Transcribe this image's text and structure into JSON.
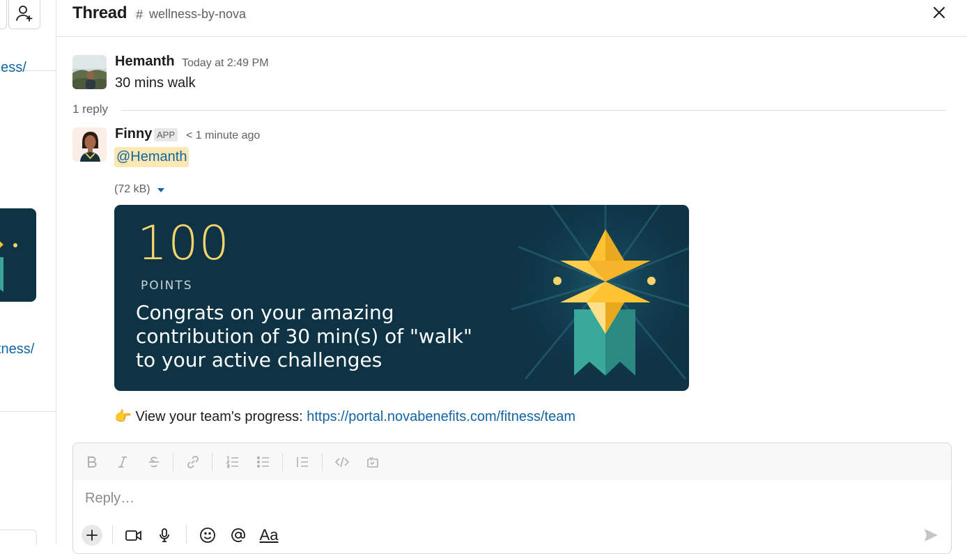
{
  "sidebar": {
    "link_fragment_1": "ness/",
    "link_fragment_2": "tness/"
  },
  "header": {
    "title": "Thread",
    "channel_hash": "#",
    "channel": "wellness-by-nova"
  },
  "parent_message": {
    "author": "Hemanth",
    "timestamp": "Today at 2:49 PM",
    "text": "30 mins walk"
  },
  "reply_count": "1 reply",
  "reply": {
    "author": "Finny",
    "badge": "APP",
    "timestamp": "< 1 minute ago",
    "mention": "@Hemanth",
    "file_size": "(72 kB)",
    "card": {
      "points": "100",
      "points_label": "POINTS",
      "message_lines": [
        "Congrats on your amazing",
        "contribution of 30 min(s) of \"walk\"",
        "to your active challenges"
      ],
      "bg_color": "#0e3345",
      "points_color": "#f7d36b"
    },
    "progress_emoji": "👉",
    "progress_text": "View your team's progress:",
    "progress_link": "https://portal.novabenefits.com/fitness/team"
  },
  "composer": {
    "placeholder": "Reply…",
    "format_label": "Aa",
    "toolbar_icons": [
      "bold-icon",
      "italic-icon",
      "strikethrough-icon",
      "link-icon",
      "ordered-list-icon",
      "bulleted-list-icon",
      "blockquote-icon",
      "code-icon",
      "code-block-icon"
    ],
    "bottom_icons": [
      "plus-icon",
      "video-icon",
      "microphone-icon",
      "emoji-icon",
      "mention-icon",
      "format-icon",
      "send-icon"
    ]
  },
  "colors": {
    "link": "#1264a3",
    "mention_bg": "#fbe7b2",
    "muted_text": "#616061"
  }
}
